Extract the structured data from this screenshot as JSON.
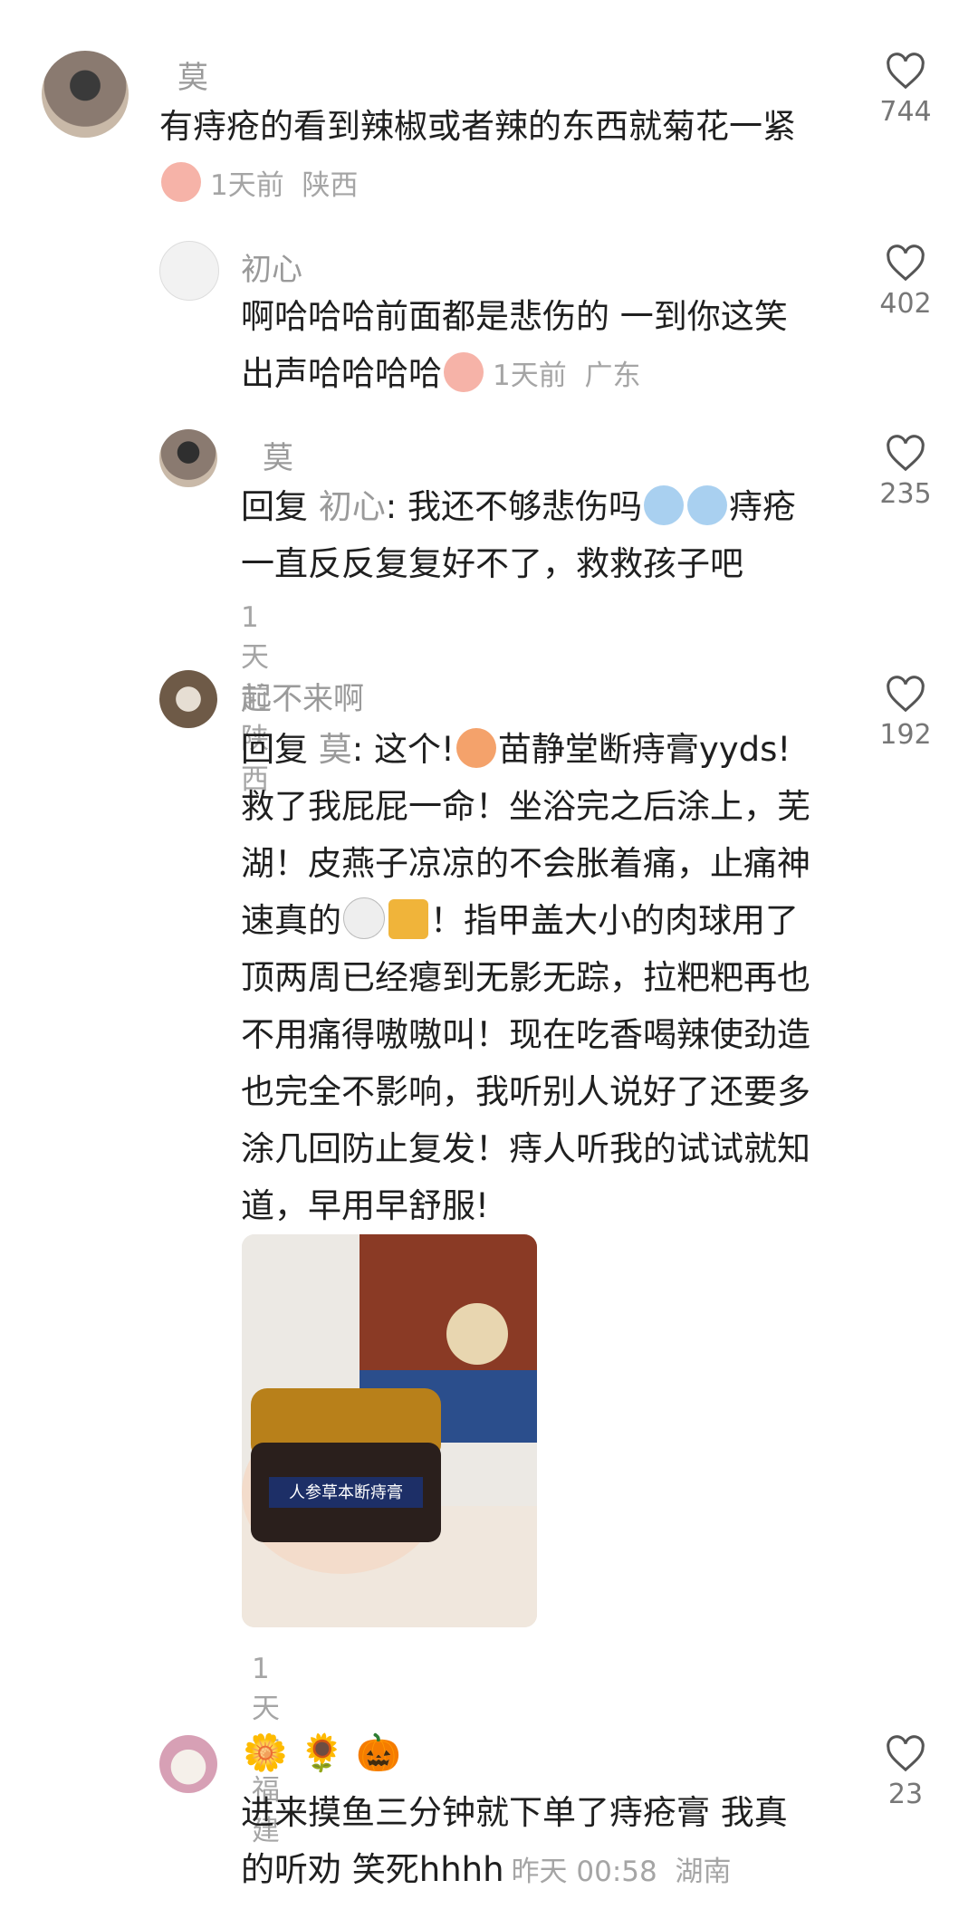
{
  "comments": [
    {
      "name": "莫",
      "text": "有痔疮的看到辣椒或者辣的东西就菊花一紧",
      "time": "1天前",
      "location": "陕西",
      "likes": "744"
    },
    {
      "name": "初心",
      "text": "啊哈哈哈前面都是悲伤的 一到你这笑出声哈哈哈哈",
      "time": "1天前",
      "location": "广东",
      "likes": "402"
    },
    {
      "name": "莫",
      "reply_prefix": "回复",
      "reply_to": "初心",
      "text_a": ": 我还不够悲伤吗",
      "text_b": "痔疮一直反反复复好不了，救救孩子吧",
      "time": "1天前",
      "location": "陕西",
      "likes": "235"
    },
    {
      "name": "起不来啊",
      "reply_prefix": "回复",
      "reply_to": "莫",
      "text_a": ": 这个!",
      "text_b": "苗静堂断痔膏yyds!救了我屁屁一命！坐浴完之后涂上，芜湖！皮燕子凉凉的不会胀着痛，止痛神速真的",
      "text_c": "！指甲盖大小的肉球用了顶两周已经瘪到无影无踪，拉粑粑再也不用痛得嗷嗷叫！现在吃香喝辣使劲造也完全不影响，我听别人说好了还要多涂几回防止复发！痔人听我的试试就知道，早用早舒服!",
      "time": "1天前",
      "location": "福建",
      "likes": "192",
      "photo_label": "人参草本断痔膏"
    },
    {
      "name_emojis": "🌼 🌻 🎃",
      "text": "进来摸鱼三分钟就下单了痔疮膏 我真的听劝 笑死hhhh",
      "time": "昨天 00:58",
      "location": "湖南",
      "likes": "23"
    }
  ],
  "icons": {
    "like": "heart-outline-icon"
  }
}
